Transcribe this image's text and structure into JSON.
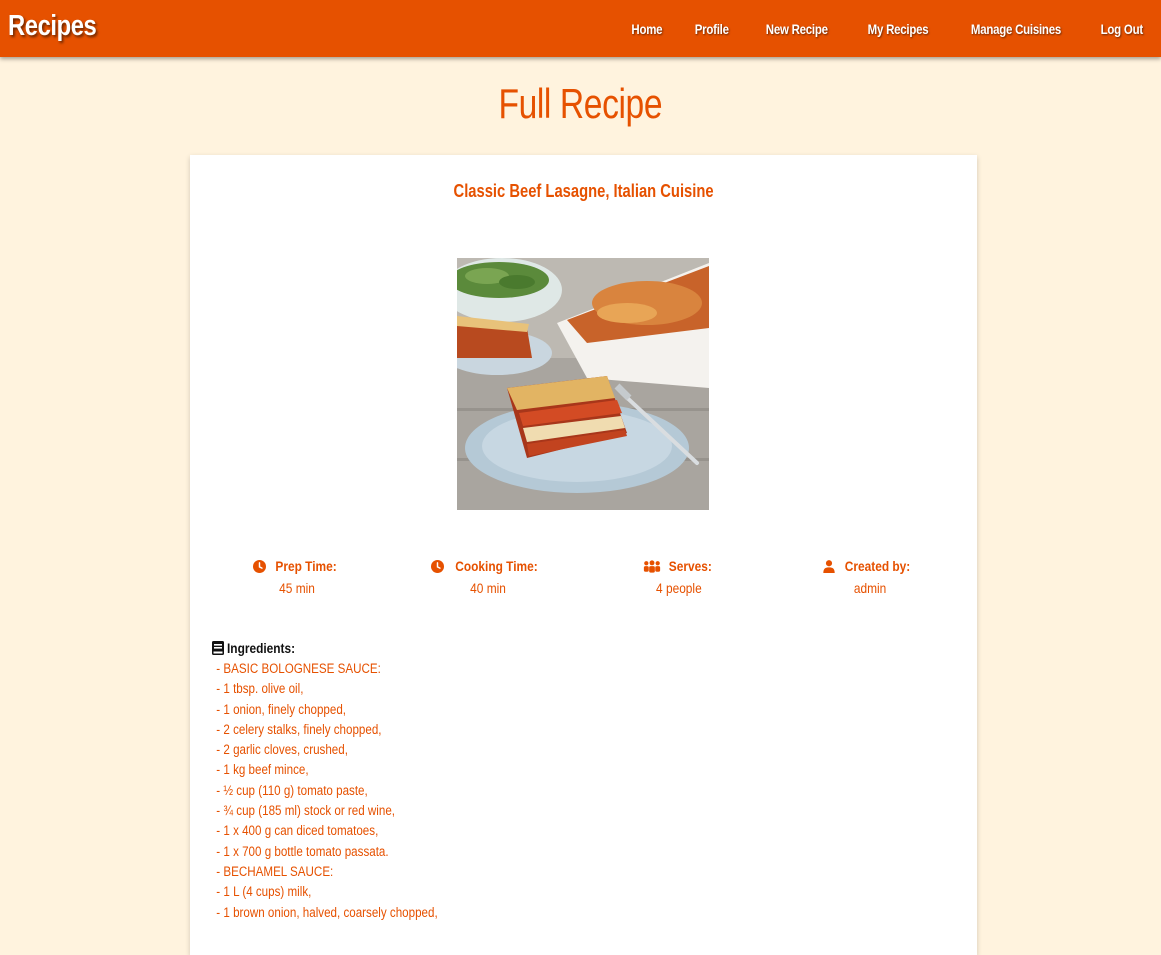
{
  "navbar": {
    "brand": "Recipes",
    "links": [
      {
        "label": "Home"
      },
      {
        "label": "Profile"
      },
      {
        "label": "New Recipe"
      },
      {
        "label": "My Recipes"
      },
      {
        "label": "Manage Cuisines"
      },
      {
        "label": "Log Out"
      }
    ]
  },
  "page": {
    "title": "Full Recipe"
  },
  "recipe": {
    "title": "Classic Beef Lasagne, Italian Cuisine",
    "image_description": "lasagne-photo",
    "info": [
      {
        "icon": "clock-icon",
        "label": "Prep Time:",
        "value": "45 min"
      },
      {
        "icon": "clock-icon",
        "label": "Cooking Time:",
        "value": "40 min"
      },
      {
        "icon": "users-icon",
        "label": "Serves:",
        "value": "4 people"
      },
      {
        "icon": "user-icon",
        "label": "Created by:",
        "value": "admin"
      }
    ],
    "ingredients_heading": "Ingredients:",
    "ingredients": [
      "- BASIC BOLOGNESE SAUCE:",
      "- 1 tbsp. olive oil,",
      "- 1 onion, finely chopped,",
      "- 2 celery stalks, finely chopped,",
      "- 2 garlic cloves, crushed,",
      "- 1 kg beef mince,",
      "- ½ cup (110 g) tomato paste,",
      "- ¾ cup (185 ml) stock or red wine,",
      "- 1 x 400 g can diced tomatoes,",
      "- 1 x 700 g bottle tomato passata.",
      "- BECHAMEL SAUCE:",
      "- 1 L (4 cups) milk,",
      "- 1 brown onion, halved, coarsely chopped,"
    ]
  },
  "colors": {
    "primary": "#e65100",
    "background": "#fff3de",
    "card": "#ffffff"
  }
}
